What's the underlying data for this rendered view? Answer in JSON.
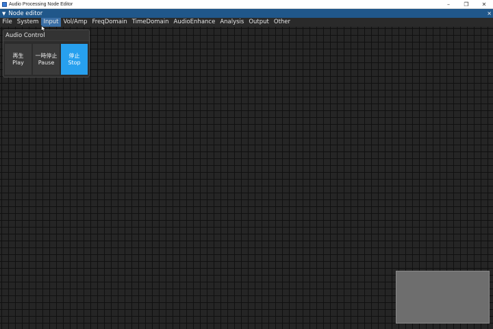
{
  "os_window": {
    "title": "Audio Processing Node Editor",
    "controls": {
      "minimize": "–",
      "maximize": "❐",
      "close": "✕"
    }
  },
  "imgui_window": {
    "title": "Node editor",
    "close": "×"
  },
  "menu": {
    "items": [
      "File",
      "System",
      "Input",
      "Vol/Amp",
      "FreqDomain",
      "TimeDomain",
      "AudioEnhance",
      "Analysis",
      "Output",
      "Other"
    ],
    "active": "Input"
  },
  "node": {
    "title": "Audio Control",
    "buttons": {
      "play": {
        "jp": "再生",
        "en": "Play"
      },
      "pause": {
        "jp": "一時停止",
        "en": "Pause"
      },
      "stop": {
        "jp": "停止",
        "en": "Stop"
      }
    }
  },
  "colors": {
    "titlebar": "#20578a",
    "stop_button": "#27a0ee",
    "menu_active": "#3a6ea5"
  }
}
